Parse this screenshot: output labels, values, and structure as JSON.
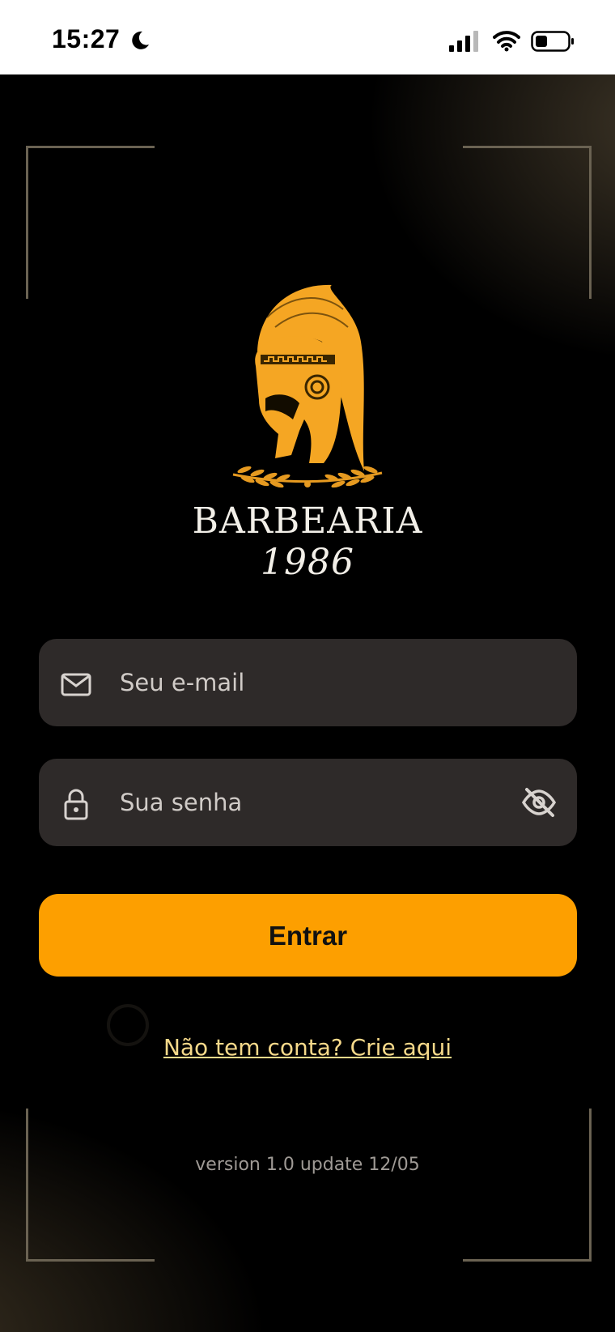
{
  "status_bar": {
    "time": "15:27",
    "icons": [
      "moon-icon",
      "cellular-signal-icon",
      "wifi-icon",
      "battery-icon"
    ]
  },
  "logo": {
    "brand_name": "BARBEARIA",
    "brand_year": "1986",
    "emblem": "spartan-helmet-with-laurel"
  },
  "form": {
    "email": {
      "placeholder": "Seu e-mail",
      "value": "",
      "icon": "mail-icon"
    },
    "password": {
      "placeholder": "Sua senha",
      "value": "",
      "icon": "lock-icon",
      "toggle_icon": "eye-off-icon"
    },
    "submit_label": "Entrar"
  },
  "signup_link": "Não tem conta? Crie aqui",
  "version": "version 1.0 update 12/05",
  "colors": {
    "accent": "#fd9f00",
    "field_bg": "#2e2a29",
    "link": "#f6d98a",
    "logo_gold": "#f5a623"
  }
}
